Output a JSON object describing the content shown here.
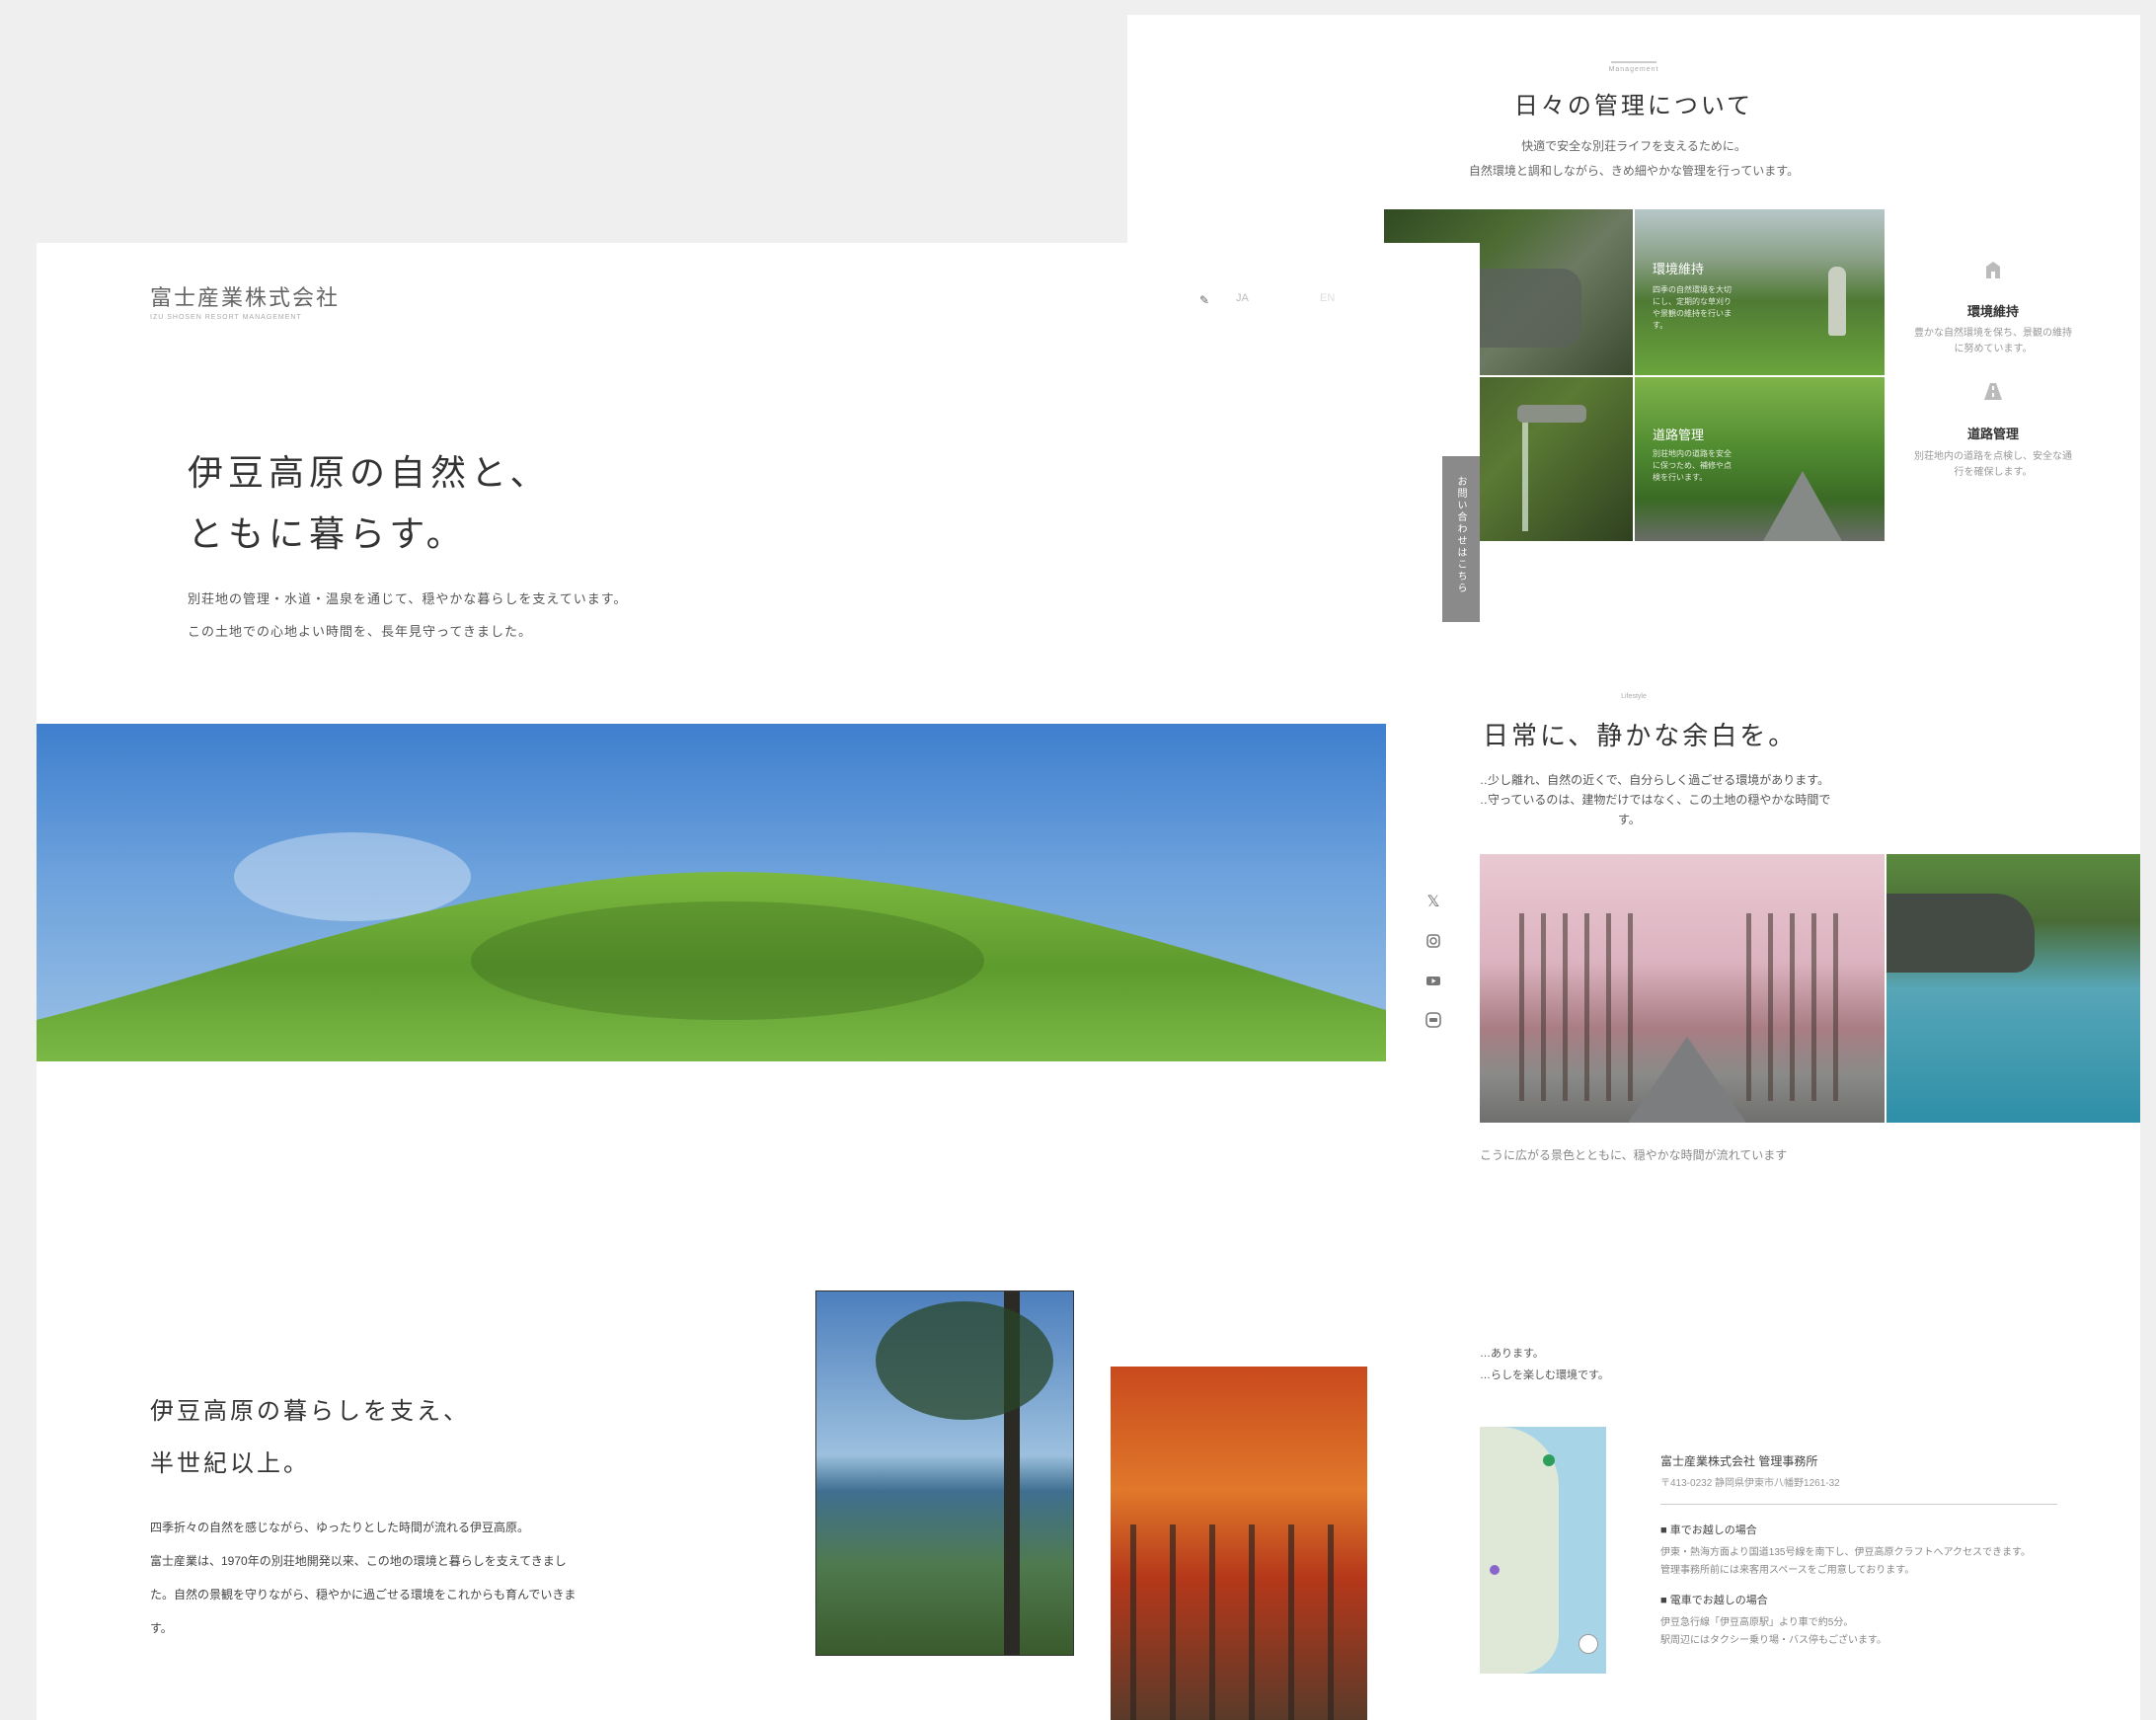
{
  "right_page": {
    "management": {
      "eyebrow": "Management",
      "title": "日々の管理について",
      "desc_line1": "快適で安全な別荘ライフを支えるために。",
      "desc_line2": "自然環境と調和しながら、きめ細やかな管理を行っています。",
      "tile_labels": {
        "environment": "環境維持",
        "road": "道路管理"
      },
      "tile_texts": {
        "environment": "四季の自然環境を大切にし、定期的な草刈りや景観の維持を行います。",
        "road": "別荘地内の道路を安全に保つため、補修や点検を行います。"
      },
      "services": [
        {
          "icon": "building-icon",
          "title": "環境維持",
          "desc": "豊かな自然環境を保ち、景観の維持に努めています。"
        },
        {
          "icon": "road-icon",
          "title": "道路管理",
          "desc": "別荘地内の道路を点検し、安全な通行を確保します。"
        }
      ]
    },
    "daily": {
      "eyebrow": "Lifestyle",
      "title": "日常に、静かな余白を。",
      "desc_line1": "…少し離れ、自然の近くで、自分らしく過ごせる環境があります。",
      "desc_line2": "…守っているのは、建物だけではなく、この土地の穏やかな時間で",
      "desc_line3": "す。",
      "caption": "こうに広がる景色とともに、穏やかな時間が流れています"
    },
    "access": {
      "partial_line1": "…あります。",
      "partial_line2": "…らしを楽しむ環境です。",
      "office_name": "富士産業株式会社 管理事務所",
      "address": "〒413-0232 静岡県伊東市八幡野1261-32",
      "car_heading": "車でお越しの場合",
      "car_text_1": "伊東・熱海方面より国道135号線を南下し、伊豆高原クラフトへアクセスできます。",
      "car_text_2": "管理事務所前には来客用スペースをご用意しております。",
      "train_heading": "電車でお越しの場合",
      "train_text_1": "伊豆急行線「伊豆高原駅」より車で約5分。",
      "train_text_2": "駅周辺にはタクシー乗り場・バス停もございます。"
    },
    "side_tab": "お問い合わせはこちら"
  },
  "left_page": {
    "header": {
      "logo_text": "富士産業株式会社",
      "logo_sub": "IZU SHOSEN RESORT MANAGEMENT",
      "nav_items": [
        "JA",
        "EN"
      ]
    },
    "hero": {
      "line1": "伊豆高原の自然と、",
      "line2": "ともに暮らす。",
      "desc_line1": "別荘地の管理・水道・温泉を通じて、穏やかな暮らしを支えています。",
      "desc_line2": "この土地での心地よい時間を、長年見守ってきました。"
    },
    "about": {
      "title_line1": "伊豆高原の暮らしを支え、",
      "title_line2": "半世紀以上。",
      "text_line1": "四季折々の自然を感じながら、ゆったりとした時間が流れる伊豆高原。",
      "text_line2": "富士産業は、1970年の別荘地開発以来、この地の環境と暮らしを支えてきまし",
      "text_line3": "た。自然の景観を守りながら、穏やかに過ごせる環境をこれからも育んでいきま",
      "text_line4": "す。"
    },
    "social_icons": [
      "x-icon",
      "instagram-icon",
      "youtube-icon",
      "line-icon"
    ]
  }
}
